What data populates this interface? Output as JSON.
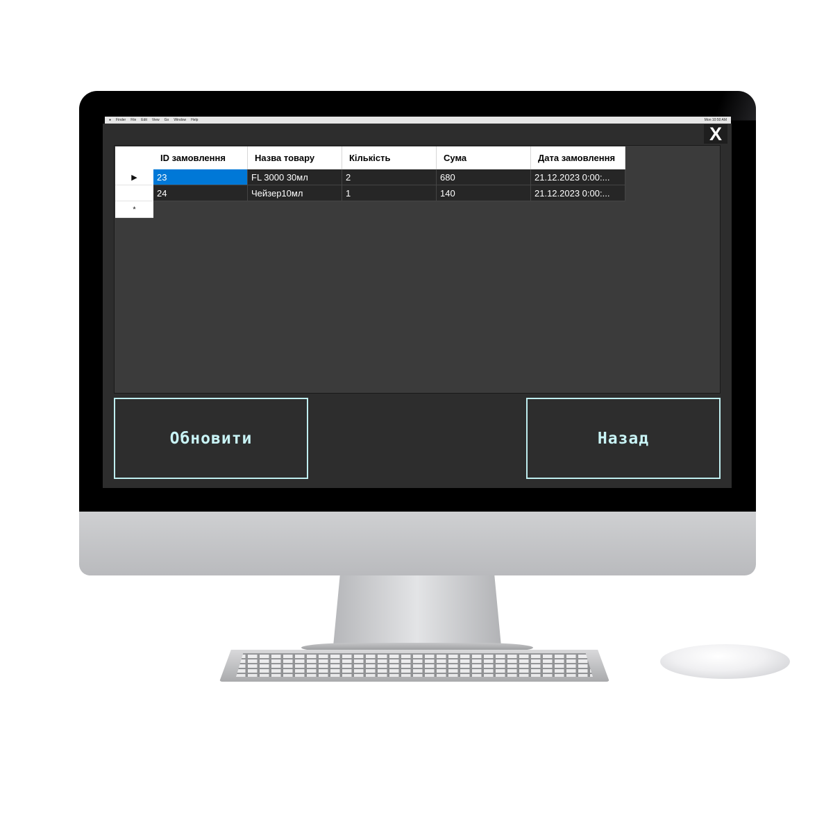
{
  "menubar": {
    "items": [
      "Finder",
      "File",
      "Edit",
      "View",
      "Go",
      "Window",
      "Help"
    ],
    "clock": "Mon 10:50 AM"
  },
  "window": {
    "close_label": "X"
  },
  "grid": {
    "columns": [
      "ID замовлення",
      "Назва товару",
      "Кількість",
      "Сума",
      "Дата замовлення"
    ],
    "rows": [
      {
        "indicator": "▶",
        "cells": [
          "23",
          "FL 3000 30мл",
          "2",
          "680",
          "21.12.2023 0:00:..."
        ]
      },
      {
        "indicator": "",
        "cells": [
          "24",
          "Чейзер10мл",
          "1",
          "140",
          "21.12.2023 0:00:..."
        ]
      }
    ],
    "new_row_indicator": "*"
  },
  "buttons": {
    "refresh_label": "Обновити",
    "back_label": "Назад"
  },
  "colors": {
    "window_bg": "#2d2d2d",
    "button_border": "#bfeef0",
    "selection": "#0078d7"
  },
  "icons": [
    "apple-icon",
    "close-icon",
    "row-pointer-icon",
    "new-row-icon"
  ]
}
